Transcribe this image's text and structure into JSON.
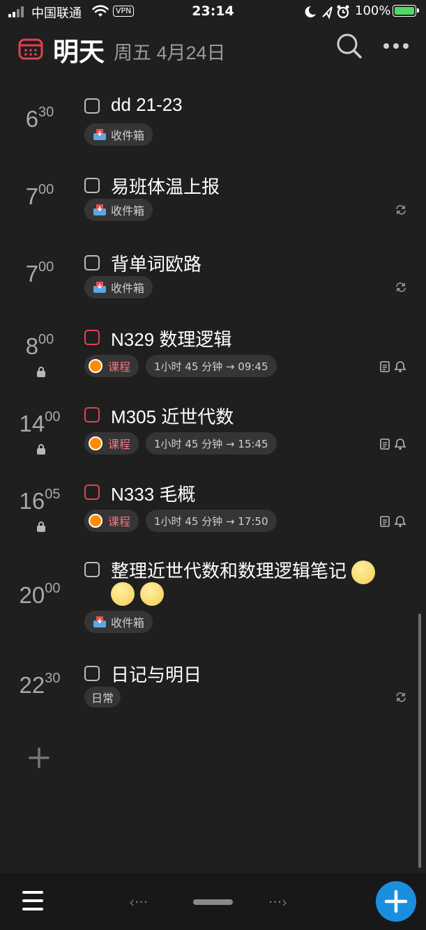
{
  "status_bar": {
    "carrier": "中国联通",
    "vpn": "VPN",
    "time": "23:14",
    "battery": "100%"
  },
  "header": {
    "title": "明天",
    "date": "周五 4月24日"
  },
  "tasks": [
    {
      "hour": "6",
      "minute": "30",
      "title": "dd 21-23",
      "tag": "收件箱",
      "checkbox": "gray",
      "repeat": false
    },
    {
      "hour": "7",
      "minute": "00",
      "title": "易班体温上报",
      "tag": "收件箱",
      "checkbox": "gray",
      "repeat": true
    },
    {
      "hour": "7",
      "minute": "00",
      "title": "背单词欧路",
      "tag": "收件箱",
      "checkbox": "gray",
      "repeat": true
    },
    {
      "hour": "8",
      "minute": "00",
      "title": "N329 数理逻辑",
      "tag": "课程",
      "duration": "1小时 45 分钟 → 09:45",
      "checkbox": "red",
      "locked": true
    },
    {
      "hour": "14",
      "minute": "00",
      "title": "M305 近世代数",
      "tag": "课程",
      "duration": "1小时 45 分钟 → 15:45",
      "checkbox": "red",
      "locked": true
    },
    {
      "hour": "16",
      "minute": "05",
      "title": "N333 毛概",
      "tag": "课程",
      "duration": "1小时 45 分钟 → 17:50",
      "checkbox": "red",
      "locked": true
    },
    {
      "hour": "20",
      "minute": "00",
      "title": "整理近世代数和数理逻辑笔记",
      "tag": "收件箱",
      "checkbox": "gray",
      "emoji_count": 3
    },
    {
      "hour": "22",
      "minute": "30",
      "title": "日记与明日",
      "tag": "日常",
      "checkbox": "gray",
      "repeat": true
    }
  ],
  "bottom_bar": {
    "prev": "‹···",
    "next": "···›"
  },
  "icons": {
    "calendar": "calendar-icon",
    "search": "search-icon",
    "more": "more-icon",
    "inbox": "inbox-tray-icon",
    "repeat": "repeat-icon",
    "note": "note-icon",
    "bell": "bell-icon",
    "lock": "lock-icon",
    "add": "plus-icon",
    "menu": "hamburger-icon"
  },
  "colors": {
    "background": "#1f1f1f",
    "accent_red": "#e0424f",
    "course_tag": "#f07683",
    "course_dot": "#ff8c00",
    "fab": "#1a8fe0",
    "battery": "#4cd964"
  }
}
